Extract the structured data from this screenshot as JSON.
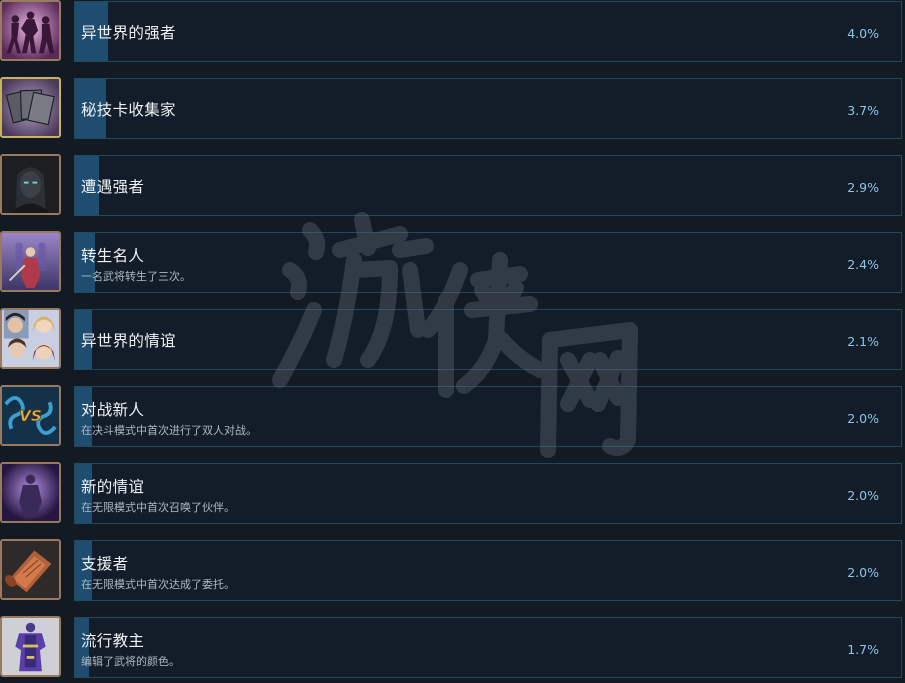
{
  "achievements": [
    {
      "name": "异世界的强者",
      "description": "",
      "percent": "4.0%",
      "percent_value": 4.0,
      "icon": "dancing-silhouettes-icon"
    },
    {
      "name": "秘技卡收集家",
      "description": "",
      "percent": "3.7%",
      "percent_value": 3.7,
      "icon": "cards-icon"
    },
    {
      "name": "遭遇强者",
      "description": "",
      "percent": "2.9%",
      "percent_value": 2.9,
      "icon": "dark-warrior-portrait-icon"
    },
    {
      "name": "转生名人",
      "description": "一名武将转生了三次。",
      "percent": "2.4%",
      "percent_value": 2.4,
      "icon": "reborn-warriors-icon"
    },
    {
      "name": "异世界的情谊",
      "description": "",
      "percent": "2.1%",
      "percent_value": 2.1,
      "icon": "heroes-group-icon"
    },
    {
      "name": "对战新人",
      "description": "在决斗模式中首次进行了双人对战。",
      "percent": "2.0%",
      "percent_value": 2.0,
      "icon": "versus-icon"
    },
    {
      "name": "新的情谊",
      "description": "在无限模式中首次召唤了伙伴。",
      "percent": "2.0%",
      "percent_value": 2.0,
      "icon": "summoned-ally-icon"
    },
    {
      "name": "支援者",
      "description": "在无限模式中首次达成了委托。",
      "percent": "2.0%",
      "percent_value": 2.0,
      "icon": "scroll-icon"
    },
    {
      "name": "流行教主",
      "description": "编辑了武将的颜色。",
      "percent": "1.7%",
      "percent_value": 1.7,
      "icon": "armor-outfit-icon"
    }
  ],
  "colors": {
    "background": "#121a24",
    "bar_fill": "#1f4d6f",
    "bar_border": "#24485c",
    "percent_text": "#8fc3e8"
  },
  "watermark": "游侠网"
}
